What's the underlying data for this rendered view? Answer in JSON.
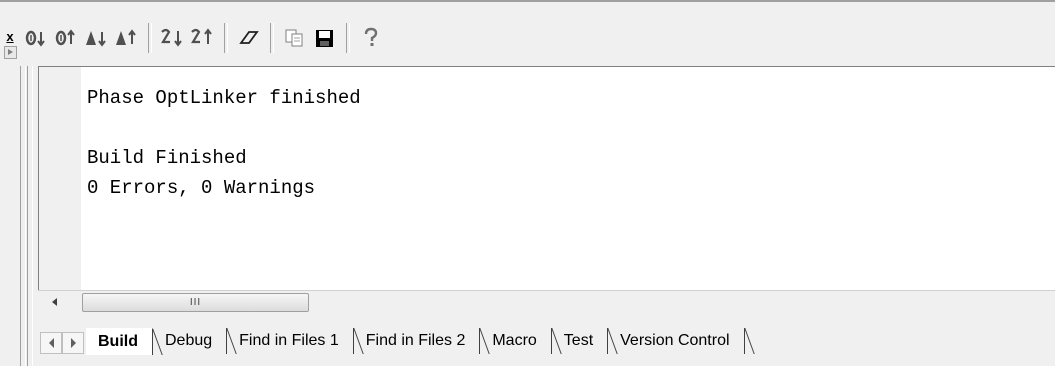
{
  "toolbar": {
    "buttons": [
      {
        "name": "next-error-icon",
        "glyph": "0↓"
      },
      {
        "name": "prev-error-icon",
        "glyph": "0↑"
      },
      {
        "name": "next-warning-icon",
        "glyph": "▲↓"
      },
      {
        "name": "prev-warning-icon",
        "glyph": "▲↑"
      },
      {
        "name": "sort-descending-icon",
        "glyph": "↯↓"
      },
      {
        "name": "sort-ascending-icon",
        "glyph": "↯↑"
      },
      {
        "name": "clear-eraser-icon",
        "glyph": "▱"
      },
      {
        "name": "copy-icon",
        "glyph": "⎘"
      },
      {
        "name": "save-icon",
        "glyph": "■"
      },
      {
        "name": "help-icon",
        "glyph": "?"
      }
    ]
  },
  "output": {
    "lines": [
      "Phase OptLinker finished",
      "",
      "Build Finished",
      "0 Errors, 0 Warnings"
    ]
  },
  "scrollbar": {
    "thumb_label": "III"
  },
  "tabs": [
    {
      "label": "Build",
      "active": true
    },
    {
      "label": "Debug",
      "active": false
    },
    {
      "label": "Find in Files 1",
      "active": false
    },
    {
      "label": "Find in Files 2",
      "active": false
    },
    {
      "label": "Macro",
      "active": false
    },
    {
      "label": "Test",
      "active": false
    },
    {
      "label": "Version Control",
      "active": false
    }
  ],
  "close_label": "x"
}
